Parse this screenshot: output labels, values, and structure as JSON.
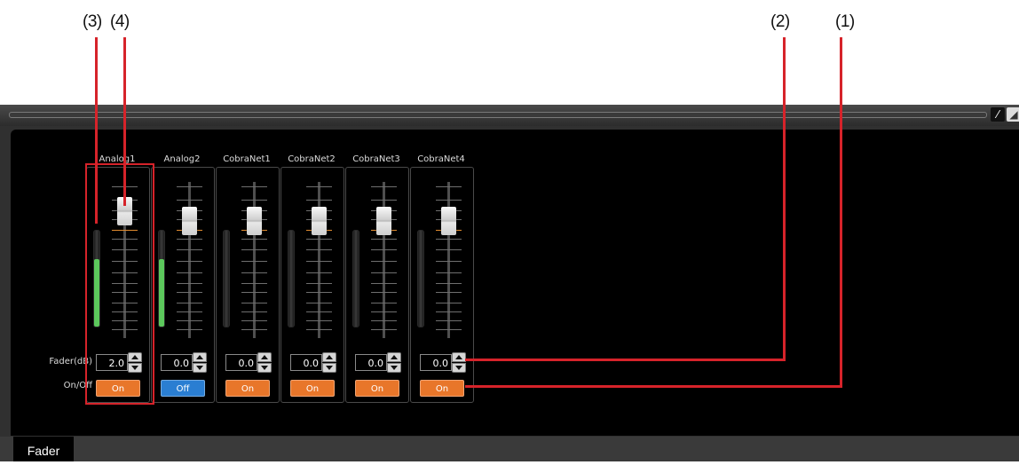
{
  "callouts": [
    "(1)",
    "(2)",
    "(3)",
    "(4)"
  ],
  "colors": {
    "accent": "#d6232a",
    "on": "#e8762a",
    "off": "#2a7ed2",
    "meter": "#5cc85c"
  },
  "tab": {
    "label": "Fader"
  },
  "row_labels": {
    "fader": "Fader(dB)",
    "onoff": "On/Off"
  },
  "channels": [
    {
      "name": "Analog1",
      "fader_db": "2.0",
      "state": "On",
      "meter_level": 0.7
    },
    {
      "name": "Analog2",
      "fader_db": "0.0",
      "state": "Off",
      "meter_level": 0.7
    },
    {
      "name": "CobraNet1",
      "fader_db": "0.0",
      "state": "On",
      "meter_level": 0
    },
    {
      "name": "CobraNet2",
      "fader_db": "0.0",
      "state": "On",
      "meter_level": 0
    },
    {
      "name": "CobraNet3",
      "fader_db": "0.0",
      "state": "On",
      "meter_level": 0
    },
    {
      "name": "CobraNet4",
      "fader_db": "0.0",
      "state": "On",
      "meter_level": 0
    }
  ]
}
